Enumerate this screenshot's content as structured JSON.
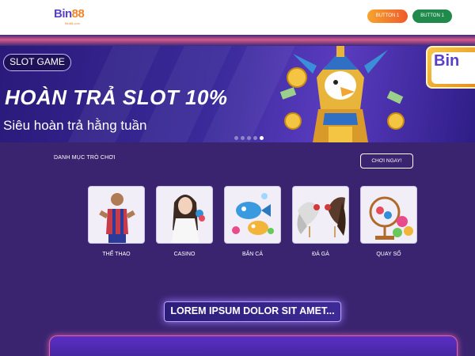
{
  "header": {
    "logo_text": "Bin",
    "logo_num": "88",
    "logo_tagline": "Bin88.com",
    "button1_label": "BUTTON 1",
    "button2_label": "BUTTON 1"
  },
  "banner": {
    "tag": "SLOT GAME",
    "title": "HOÀN TRẢ SLOT 10%",
    "subtitle": "Siêu hoàn trả hằng tuần",
    "badge_text": "Bin",
    "slides_total": 5,
    "active_slide": 4
  },
  "section": {
    "label": "DANH MỤC TRÒ CHƠI",
    "play_now_label": "CHƠI NGAY!"
  },
  "categories": [
    {
      "label": "THỂ THAO",
      "icon": "football-player"
    },
    {
      "label": "CASINO",
      "icon": "casino-dealer"
    },
    {
      "label": "BẮN CÁ",
      "icon": "fish-shooting"
    },
    {
      "label": "ĐÁ GÀ",
      "icon": "cockfighting"
    },
    {
      "label": "QUAY SỐ",
      "icon": "lottery-balls"
    }
  ],
  "lorem_button": "LOREM IPSUM DOLOR SIT AMET...",
  "colors": {
    "brand_purple": "#5a3fc9",
    "brand_orange": "#f0852a",
    "page_bg": "#3a2470",
    "button2_green": "#1f8a4c"
  }
}
